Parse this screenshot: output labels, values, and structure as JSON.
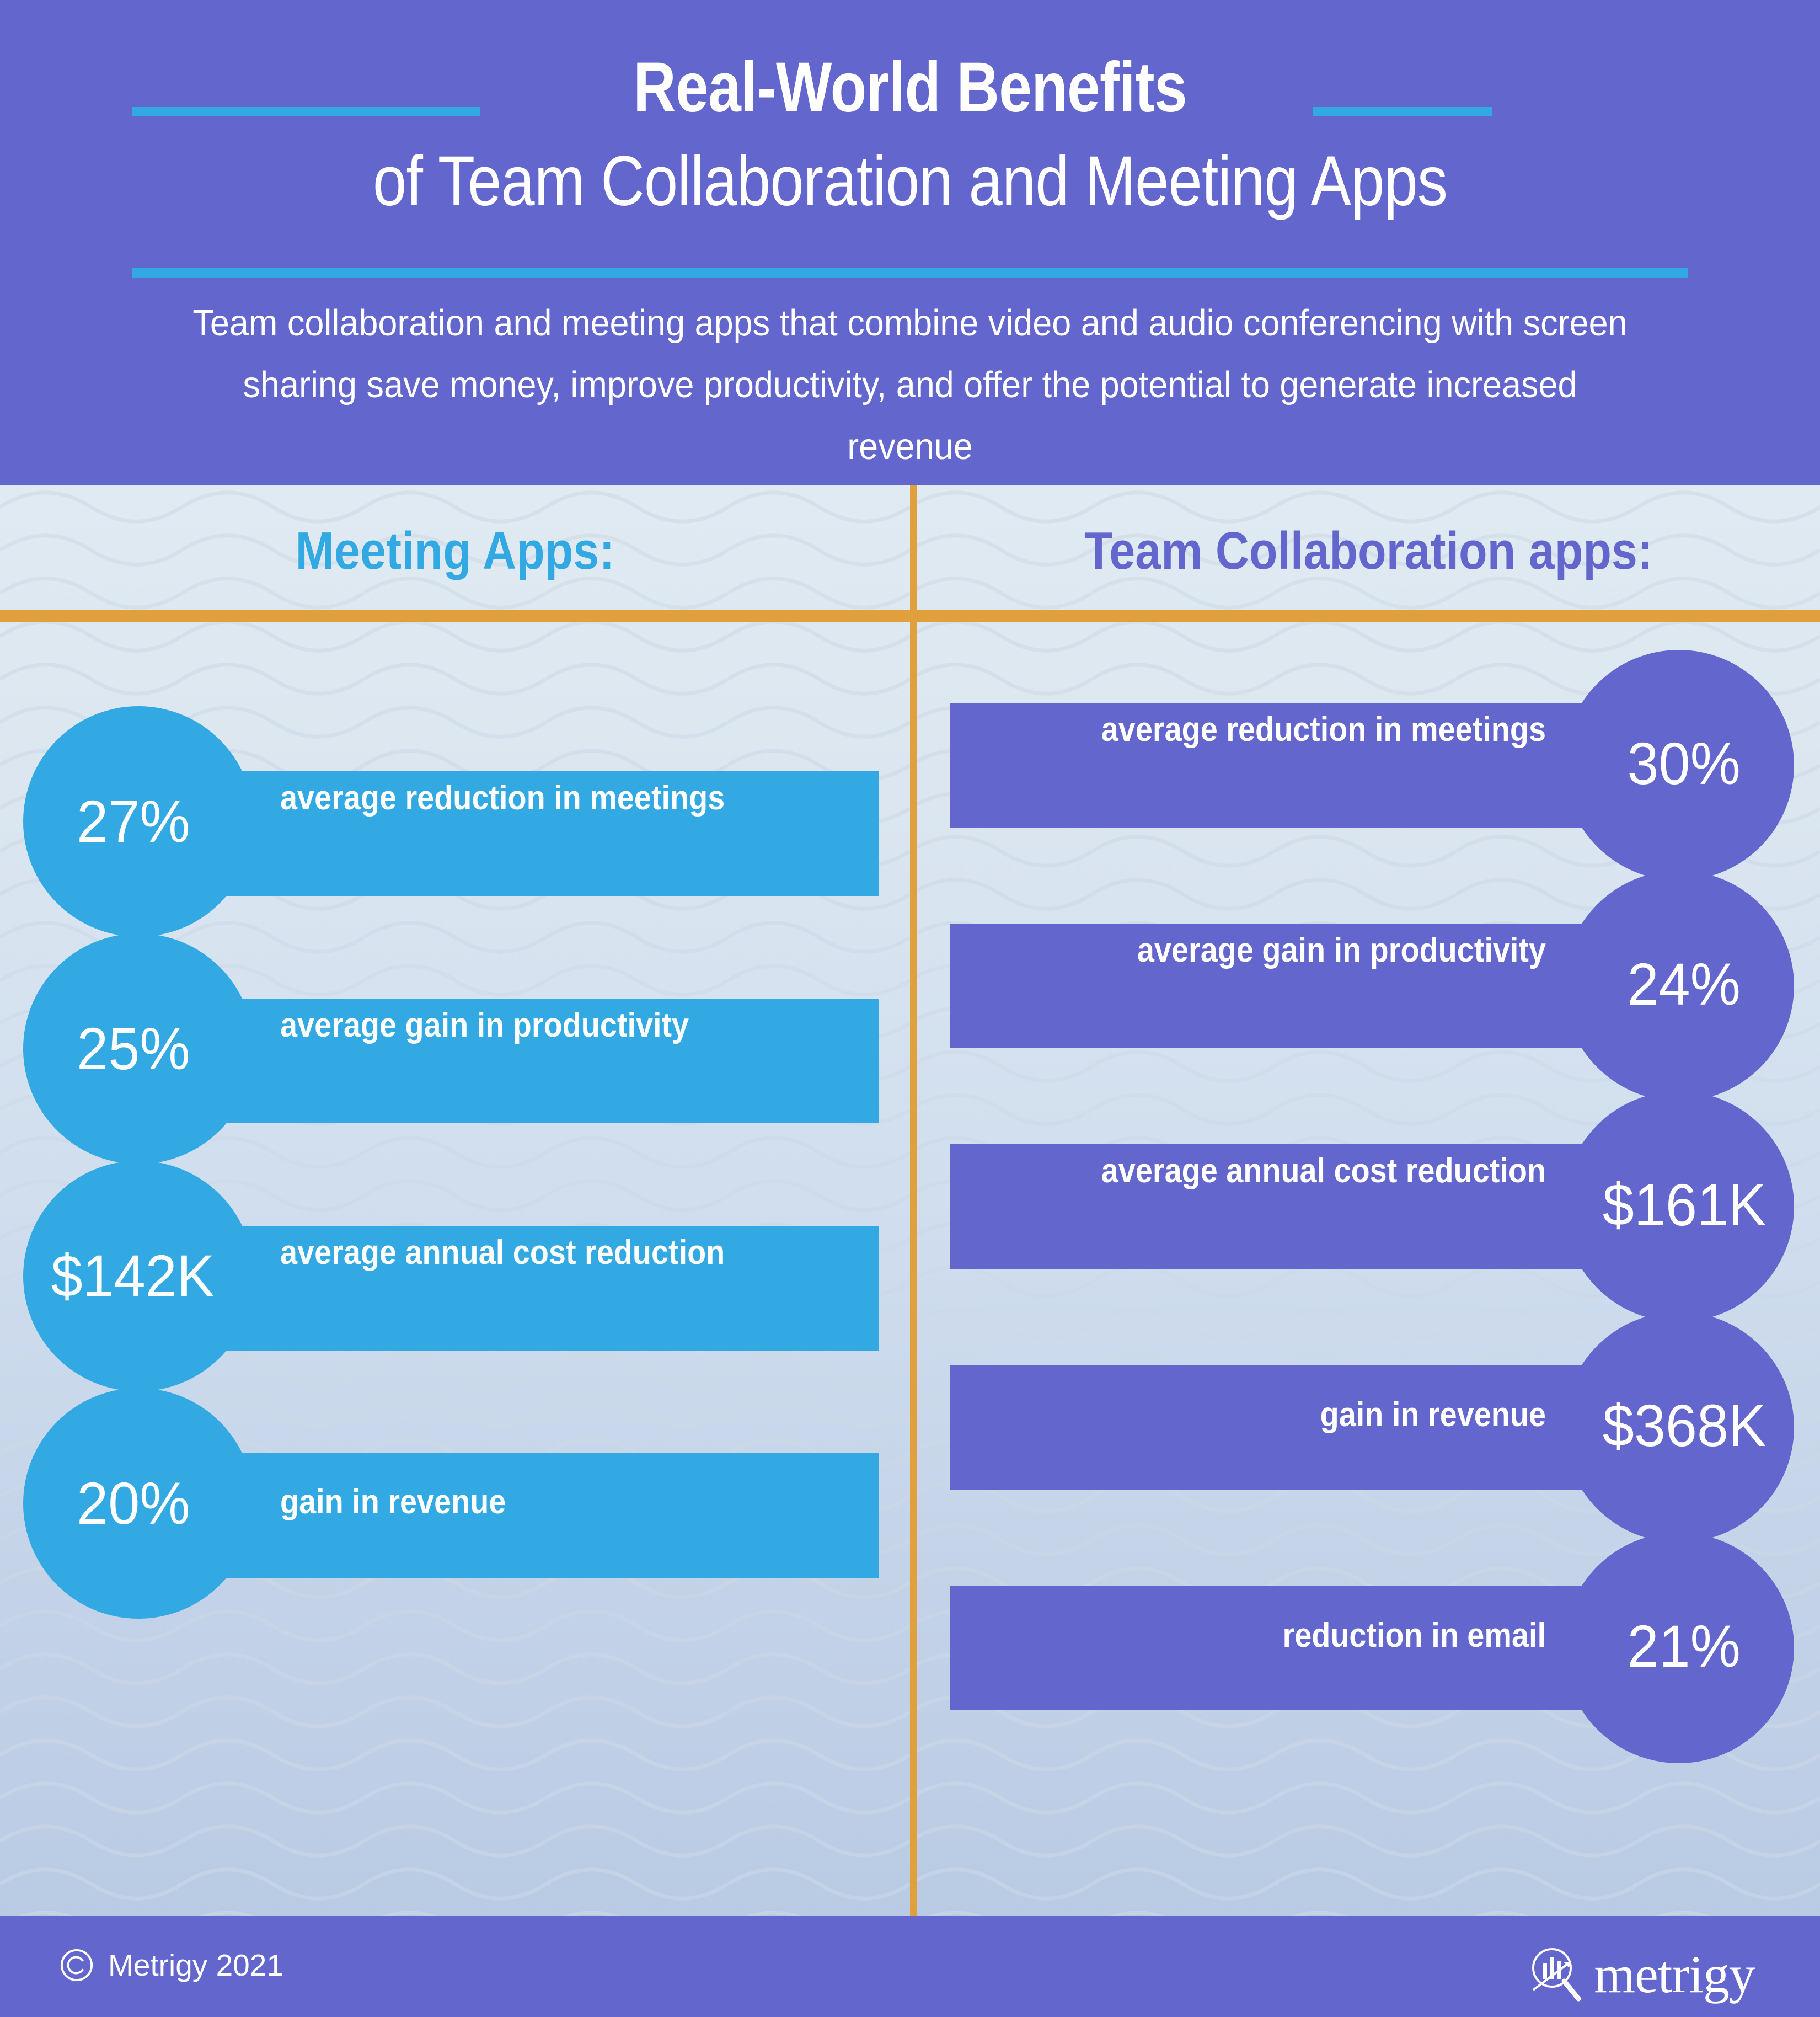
{
  "header": {
    "title_line1": "Real-World Benefits",
    "title_line2": "of Team Collaboration and Meeting Apps",
    "subtitle": "Team collaboration and meeting apps that combine video and audio conferencing with screen sharing save money, improve productivity, and offer the potential to generate increased revenue"
  },
  "columns": {
    "left_heading": "Meeting Apps:",
    "right_heading": "Team Collaboration apps:"
  },
  "meeting_apps": [
    {
      "value": "27%",
      "label": "average reduction in meetings"
    },
    {
      "value": "25%",
      "label": "average gain in productivity"
    },
    {
      "value": "$142K",
      "label": "average annual cost reduction"
    },
    {
      "value": "20%",
      "label": "gain in revenue"
    }
  ],
  "team_collaboration_apps": [
    {
      "value": "30%",
      "label": "average reduction in meetings"
    },
    {
      "value": "24%",
      "label": "average gain in productivity"
    },
    {
      "value": "$161K",
      "label": "average annual cost reduction"
    },
    {
      "value": "$368K",
      "label": "gain in revenue"
    },
    {
      "value": "21%",
      "label": "reduction in email"
    }
  ],
  "footer": {
    "copyright": "Metrigy 2021",
    "logo_text": "metrigy"
  },
  "colors": {
    "brand_purple": "#6366cc",
    "brand_blue": "#33a9e3",
    "divider_orange": "#e0a03e",
    "panel_bg": "#dbe6f0",
    "text_on_dark": "#ffffff"
  },
  "chart_data": {
    "type": "bar",
    "title": "Real-World Benefits of Team Collaboration and Meeting Apps",
    "categories": [
      "average reduction in meetings",
      "average gain in productivity",
      "average annual cost reduction",
      "gain in revenue",
      "reduction in email"
    ],
    "series": [
      {
        "name": "Meeting Apps:",
        "values": [
          "27%",
          "25%",
          "$142K",
          "20%",
          null
        ]
      },
      {
        "name": "Team Collaboration apps:",
        "values": [
          "30%",
          "24%",
          "$161K",
          "$368K",
          "21%"
        ]
      }
    ],
    "legend": "none",
    "grid": false
  }
}
